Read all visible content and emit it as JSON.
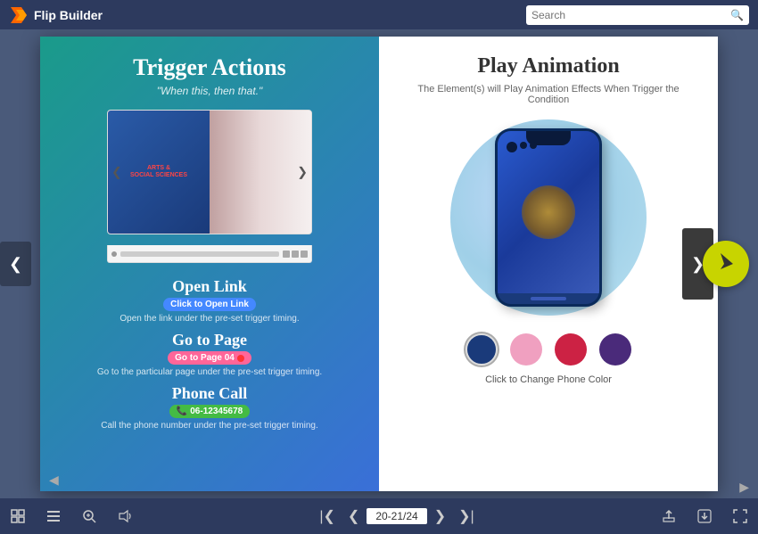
{
  "app": {
    "name": "Flip Builder",
    "logo_text": "Flip Builder"
  },
  "search": {
    "placeholder": "Search"
  },
  "left_page": {
    "title": "Trigger Actions",
    "subtitle": "\"When this, then that.\"",
    "flipbook_label_line1": "ARTS &",
    "flipbook_label_line2": "SOCIAL SCIENCES",
    "action1": {
      "title": "Open Link",
      "badge": "Click to Open Link",
      "badge_color": "badge-blue",
      "desc": "Open the link under the pre-set trigger timing."
    },
    "action2": {
      "title": "Go to Page",
      "badge": "Go to Page 04",
      "badge_color": "badge-pink",
      "desc": "Go to the particular page under the pre-set trigger timing."
    },
    "action3": {
      "title": "Phone Call",
      "badge": "06-12345678",
      "badge_color": "badge-green",
      "desc": "Call the phone number under the pre-set trigger timing."
    }
  },
  "right_page": {
    "title": "Play Animation",
    "subtitle": "The Element(s) will Play Animation Effects When Trigger the Condition",
    "phone_colors": [
      {
        "name": "Dark Blue",
        "hex": "#1a3a7a"
      },
      {
        "name": "Pink",
        "hex": "#f0a0c0"
      },
      {
        "name": "Red",
        "hex": "#cc2244"
      },
      {
        "name": "Purple",
        "hex": "#4a2a7a"
      }
    ],
    "color_change_label": "Click to Change Phone Color"
  },
  "bottom_bar": {
    "page_indicator": "20-21/24",
    "icons": {
      "grid": "⊞",
      "list": "≡",
      "zoom": "⊕",
      "sound": "♪",
      "first": "⏮",
      "prev": "←",
      "next": "→",
      "last": "⏭",
      "upload": "↑",
      "fullscreen_exit": "⛶",
      "fullscreen": "⛶"
    }
  }
}
